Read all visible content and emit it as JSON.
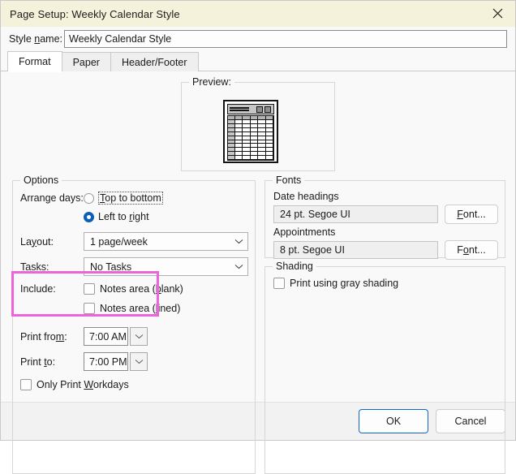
{
  "window": {
    "title": "Page Setup: Weekly Calendar Style",
    "close_icon": "close-icon",
    "titlebar_color": "#F5F2DC"
  },
  "style_name": {
    "label_pre": "Style ",
    "label_accel": "n",
    "label_post": "ame:",
    "value": "Weekly Calendar Style"
  },
  "tabs": [
    {
      "label": "Format",
      "active": true
    },
    {
      "label": "Paper",
      "active": false
    },
    {
      "label": "Header/Footer",
      "active": false
    }
  ],
  "preview": {
    "legend": "Preview:"
  },
  "options": {
    "legend": "Options",
    "arrange_days": {
      "label": "Arrange days:",
      "choices": [
        {
          "pre": "",
          "accel": "T",
          "post": "op to bottom",
          "selected": false,
          "focused": true
        },
        {
          "pre": "Left to ",
          "accel": "r",
          "post": "ight",
          "selected": true,
          "focused": false
        }
      ]
    },
    "layout": {
      "label_pre": "La",
      "label_accel": "y",
      "label_post": "out:",
      "value": "1 page/week"
    },
    "tasks": {
      "label_pre": "T",
      "label_accel": "a",
      "label_post": "sks:",
      "value": "No Tasks"
    },
    "include": {
      "label": "Include:",
      "items": [
        {
          "pre": "Notes area (",
          "accel": "b",
          "post": "lank)",
          "checked": false
        },
        {
          "pre": "Notes area (",
          "accel": "l",
          "post": "ined)",
          "checked": false
        }
      ]
    },
    "print_from": {
      "label_pre": "Print fro",
      "label_accel": "m",
      "label_post": ":",
      "value": "7:00 AM"
    },
    "print_to": {
      "label_pre": "Print ",
      "label_accel": "t",
      "label_post": "o:",
      "value": "7:00 PM"
    },
    "only_print_workdays": {
      "pre": "Only Print ",
      "accel": "W",
      "post": "orkdays",
      "checked": false
    },
    "highlight_color": "#EE62DC"
  },
  "fonts": {
    "legend": "Fonts",
    "date_headings": {
      "label": "Date headings",
      "value": "24 pt. Segoe UI",
      "button_pre": "",
      "button_accel": "F",
      "button_post": "ont..."
    },
    "appointments": {
      "label": "Appointments",
      "value": "8 pt. Segoe UI",
      "button_pre": "F",
      "button_accel": "o",
      "button_post": "nt..."
    }
  },
  "shading": {
    "legend": "Shading",
    "checkbox": {
      "pre": "Print using ",
      "accel": "g",
      "post": "ray shading",
      "checked": false
    }
  },
  "footer": {
    "ok_label": "OK",
    "cancel_label": "Cancel",
    "default_button_border": "#1168C4"
  }
}
